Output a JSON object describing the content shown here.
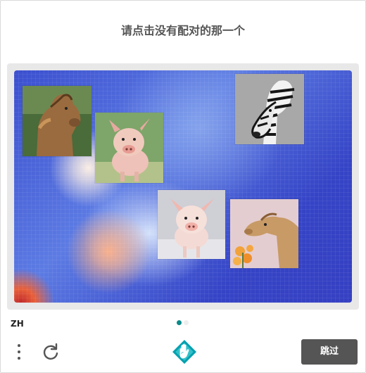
{
  "prompt": "请点击没有配对的那一个",
  "footer": {
    "language": "ZH",
    "skip_label": "跳过",
    "pagination": {
      "current": 1,
      "total": 2
    }
  },
  "icons": {
    "menu": "vertical-dots-icon",
    "refresh": "refresh-icon",
    "logo": "hcaptcha-hand-logo"
  },
  "tiles": [
    {
      "animal": "camel",
      "name": "camel-tile-1"
    },
    {
      "animal": "pig",
      "name": "pig-tile-1"
    },
    {
      "animal": "zebra",
      "name": "zebra-tile"
    },
    {
      "animal": "pig",
      "name": "pig-tile-2"
    },
    {
      "animal": "camel",
      "name": "camel-tile-2"
    }
  ],
  "colors": {
    "accent": "#0a8a8a",
    "button": "#555555",
    "prompt_text": "#555555"
  }
}
